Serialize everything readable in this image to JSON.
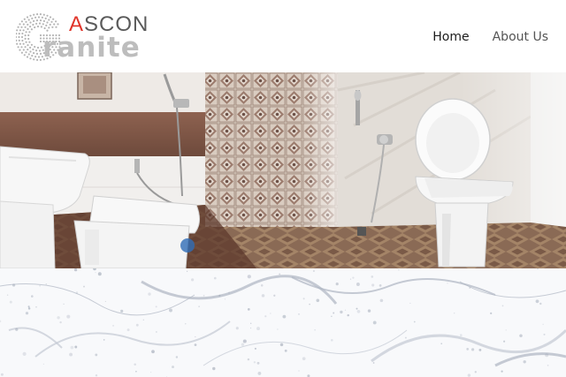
{
  "brand": {
    "logo_top": "ASCON",
    "logo_bottom": "ranite",
    "logo_initial": "G",
    "accent_color": "#e0342a"
  },
  "nav": {
    "items": [
      {
        "label": "Home",
        "active": true
      },
      {
        "label": "About Us",
        "active": false
      }
    ]
  },
  "hero": {
    "image": "bathroom-interior"
  },
  "section": {
    "background": "marble-texture"
  }
}
